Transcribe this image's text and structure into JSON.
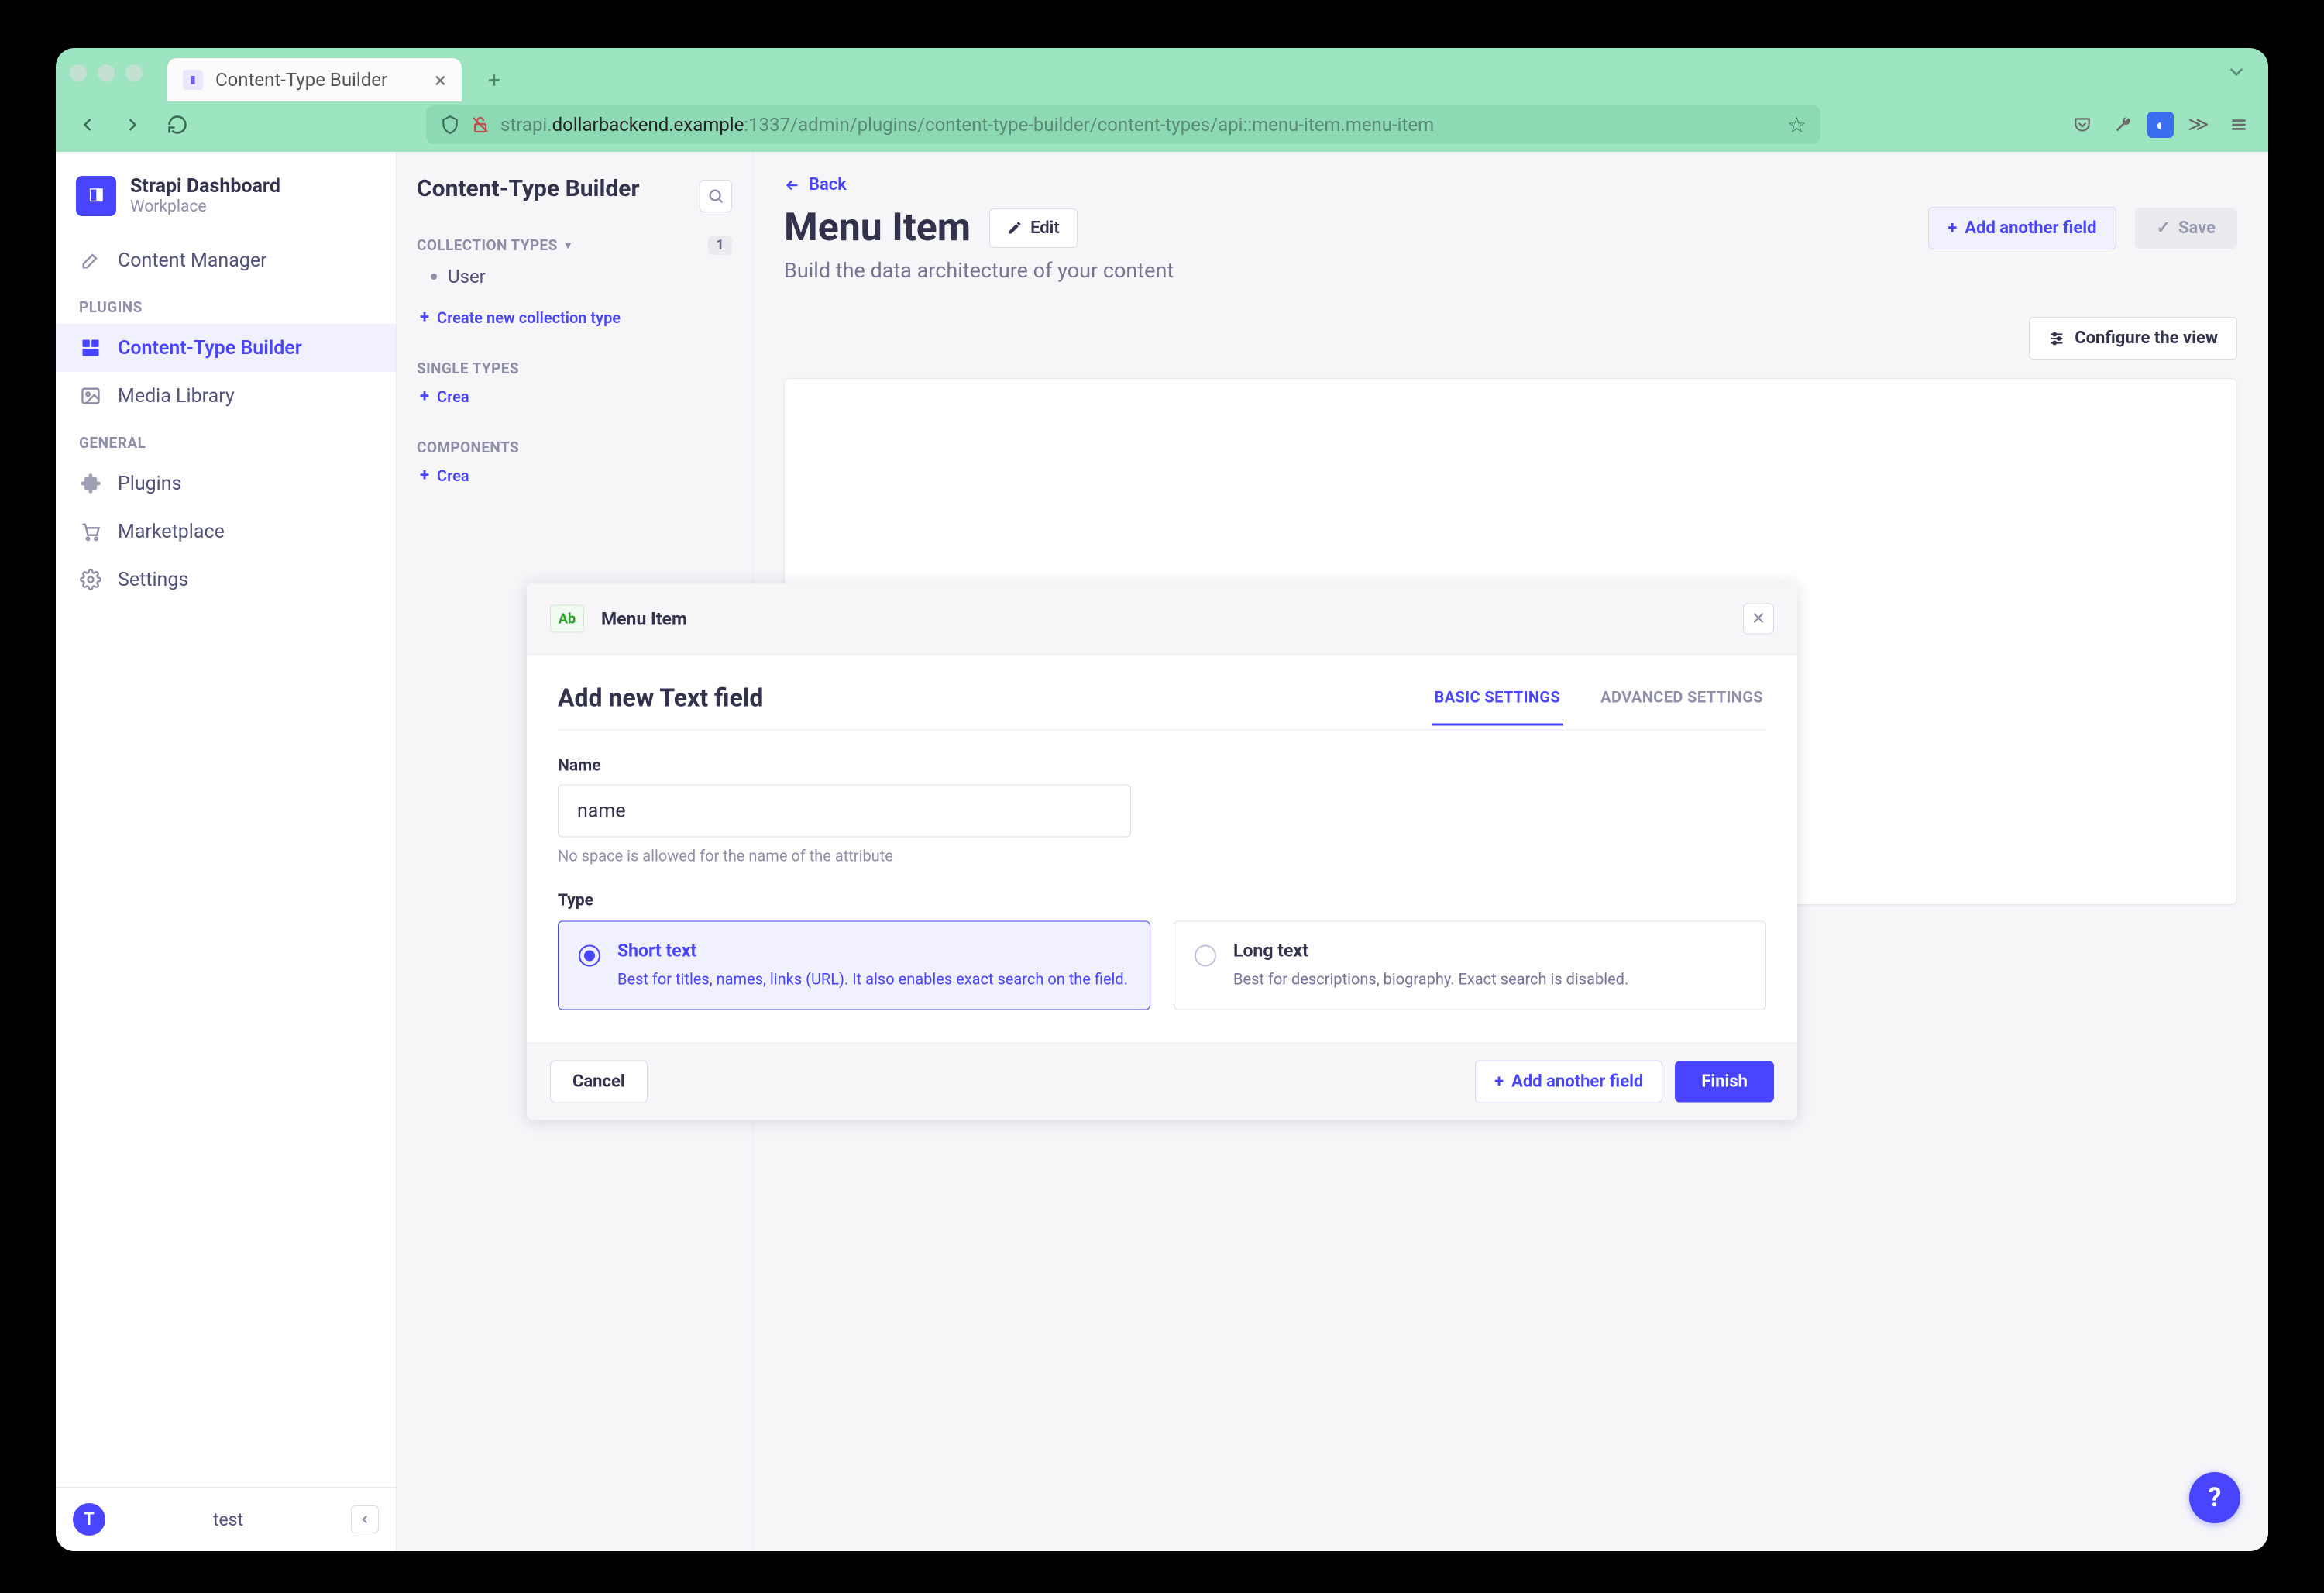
{
  "browser": {
    "tab_title": "Content-Type Builder",
    "url_prefix": "strapi.",
    "url_host": "dollarbackend.example",
    "url_path": ":1337/admin/plugins/content-type-builder/content-types/api::menu-item.menu-item"
  },
  "brand": {
    "title": "Strapi Dashboard",
    "subtitle": "Workplace"
  },
  "nav": {
    "content_manager": "Content Manager",
    "plugins_label": "PLUGINS",
    "content_type_builder": "Content-Type Builder",
    "media_library": "Media Library",
    "general_label": "GENERAL",
    "plugins": "Plugins",
    "marketplace": "Marketplace",
    "settings": "Settings",
    "footer_initial": "T",
    "footer_name": "test"
  },
  "secondary": {
    "title": "Content-Type Builder",
    "collection_types": "COLLECTION TYPES",
    "collection_count": "1",
    "user": "User",
    "create_collection": "Create new collection type",
    "single_types": "SINGLE TYPES",
    "create_single_prefix": "Crea",
    "components": "COMPONENTS",
    "create_component_prefix": "Crea"
  },
  "main": {
    "back": "Back",
    "title": "Menu Item",
    "edit": "Edit",
    "add_another_field": "Add another field",
    "save": "Save",
    "subtitle": "Build the data architecture of your content",
    "configure_view": "Configure the view"
  },
  "modal": {
    "badge": "Ab",
    "head_title": "Menu Item",
    "title": "Add new Text field",
    "tab_basic": "BASIC SETTINGS",
    "tab_advanced": "ADVANCED SETTINGS",
    "name_label": "Name",
    "name_value": "name",
    "name_help": "No space is allowed for the name of the attribute",
    "type_label": "Type",
    "short_title": "Short text",
    "short_desc": "Best for titles, names, links (URL). It also enables exact search on the field.",
    "long_title": "Long text",
    "long_desc": "Best for descriptions, biography. Exact search is disabled.",
    "cancel": "Cancel",
    "add_another": "Add another field",
    "finish": "Finish"
  },
  "help": "?"
}
